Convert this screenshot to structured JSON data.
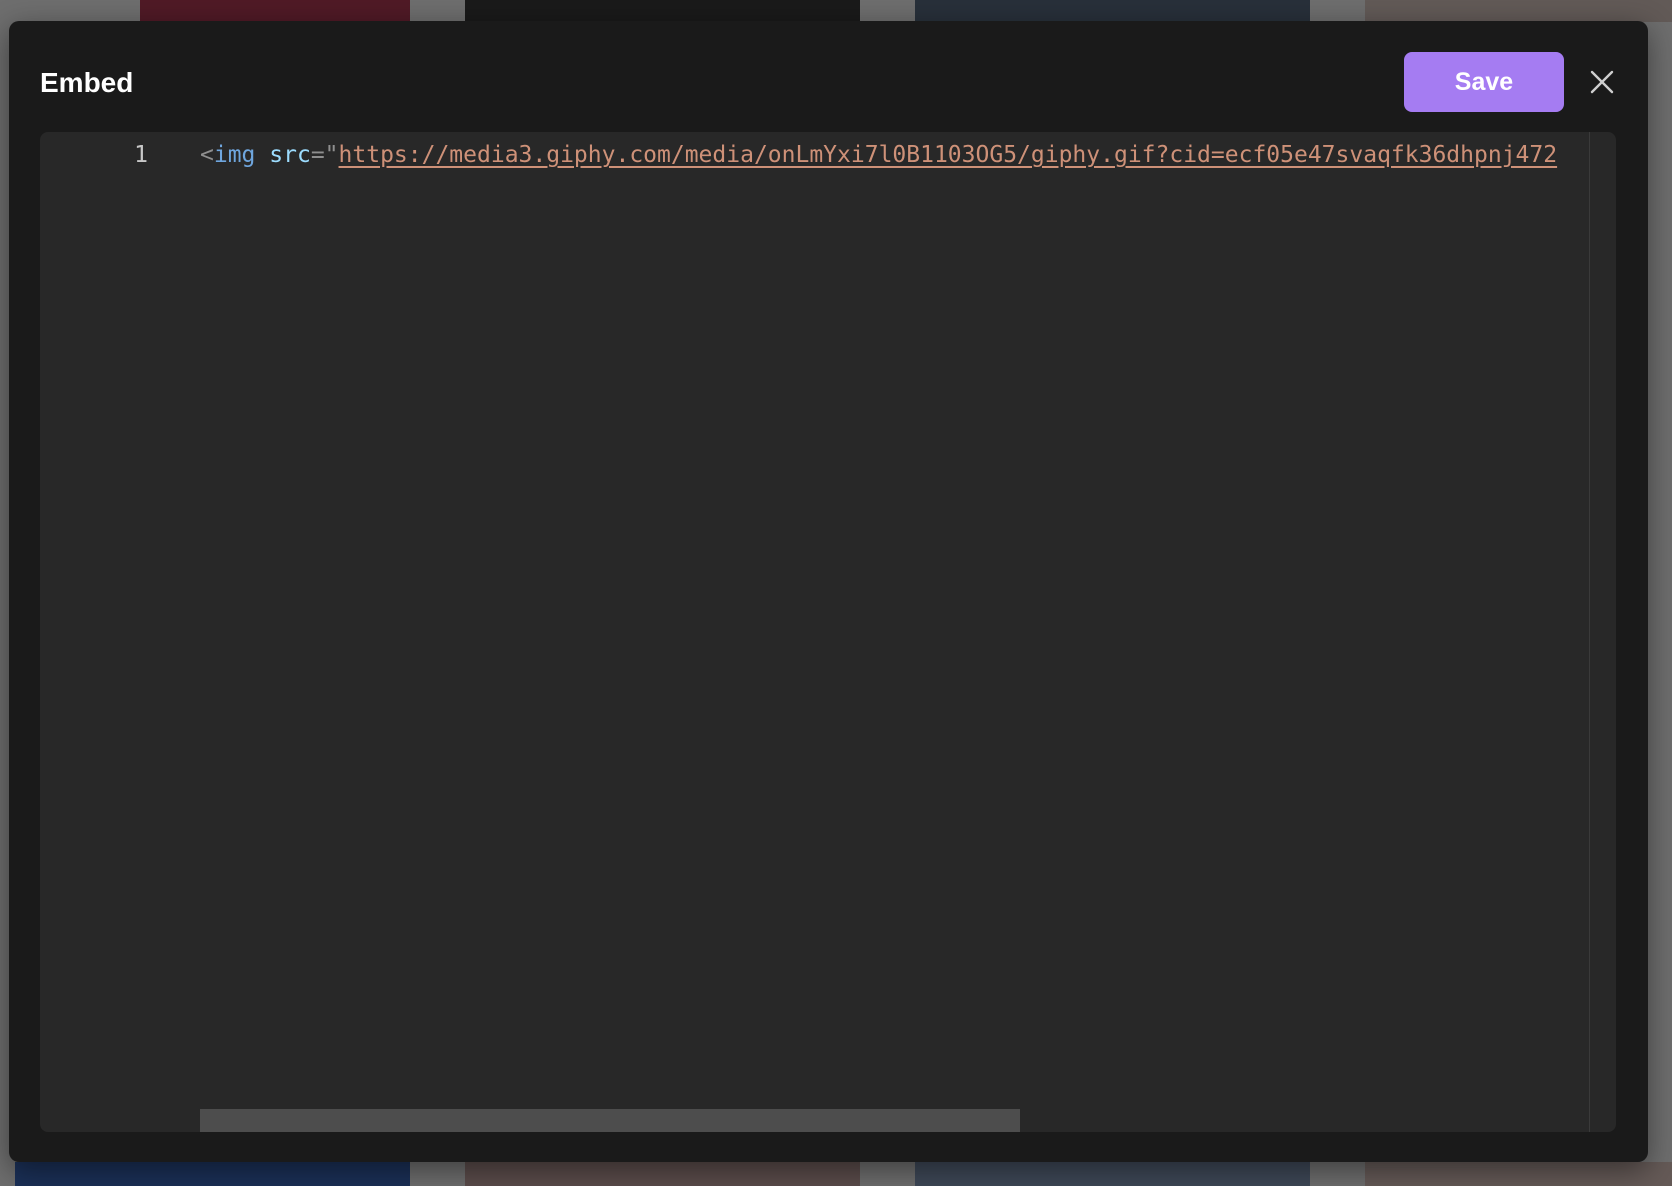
{
  "dialog": {
    "title": "Embed",
    "save_label": "Save",
    "close_icon": "close-icon"
  },
  "editor": {
    "lines": [
      {
        "number": "1",
        "tokens": {
          "open_bracket": "<",
          "tag": "img",
          "attr": "src",
          "equals": "=",
          "quote": "\"",
          "url": "https://media3.giphy.com/media/onLmYxi7l0B1103OG5/giphy.gif?cid=ecf05e47svaqfk36dhpnj472"
        }
      }
    ]
  },
  "colors": {
    "accent": "#a57cf2",
    "modal_bg": "#1a1a1a",
    "editor_bg": "#282828",
    "string": "#ce9178",
    "tag": "#6fa6de",
    "attr": "#9cdcfe"
  }
}
